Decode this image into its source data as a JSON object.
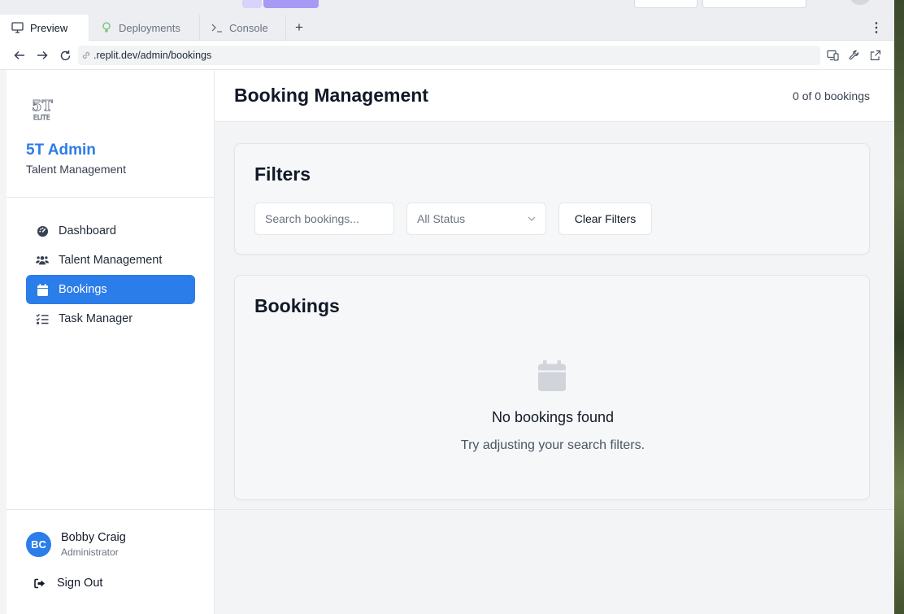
{
  "browser": {
    "tabs": [
      {
        "label": "Preview",
        "icon": "monitor-icon",
        "active": true
      },
      {
        "label": "Deployments",
        "icon": "deploy-icon",
        "active": false
      },
      {
        "label": "Console",
        "icon": "terminal-icon",
        "active": false
      }
    ],
    "url": ".replit.dev/admin/bookings"
  },
  "sidebar": {
    "brand_title": "5T Admin",
    "brand_subtitle": "Talent Management",
    "nav": [
      {
        "label": "Dashboard",
        "icon": "gauge-icon",
        "active": false
      },
      {
        "label": "Talent Management",
        "icon": "users-icon",
        "active": false
      },
      {
        "label": "Bookings",
        "icon": "calendar-icon",
        "active": true
      },
      {
        "label": "Task Manager",
        "icon": "task-list-icon",
        "active": false
      }
    ],
    "user": {
      "initials": "BC",
      "name": "Bobby Craig",
      "role": "Administrator"
    },
    "sign_out": "Sign Out"
  },
  "main": {
    "title": "Booking Management",
    "count": "0 of 0 bookings",
    "filters": {
      "title": "Filters",
      "search_placeholder": "Search bookings...",
      "status_value": "All Status",
      "clear_label": "Clear Filters"
    },
    "bookings": {
      "title": "Bookings",
      "empty_title": "No bookings found",
      "empty_subtitle": "Try adjusting your search filters."
    }
  },
  "colors": {
    "accent": "#2b7de9",
    "background": "#f3f4f6"
  }
}
